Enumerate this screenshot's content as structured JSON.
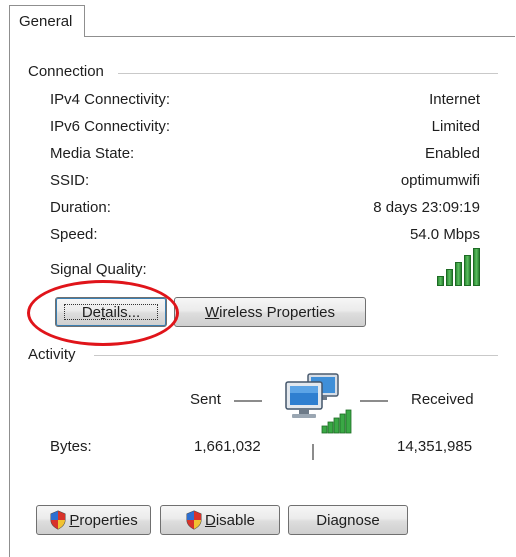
{
  "tabs": [
    {
      "label": "General"
    }
  ],
  "connection": {
    "title": "Connection",
    "rows": [
      {
        "label": "IPv4 Connectivity:",
        "value": "Internet"
      },
      {
        "label": "IPv6 Connectivity:",
        "value": "Limited"
      },
      {
        "label": "Media State:",
        "value": "Enabled"
      },
      {
        "label": "SSID:",
        "value": "optimumwifi"
      },
      {
        "label": "Duration:",
        "value": "8 days 23:09:19"
      },
      {
        "label": "Speed:",
        "value": "54.0 Mbps"
      }
    ],
    "signal_label": "Signal Quality:",
    "signal_bars_filled": 5,
    "signal_bars_total": 5,
    "details_button": {
      "prefix": "De",
      "underlined": "t",
      "suffix": "ails..."
    },
    "wireless_button": {
      "underlined": "W",
      "suffix": "ireless Properties"
    }
  },
  "activity": {
    "title": "Activity",
    "sent_label": "Sent",
    "received_label": "Received",
    "bytes_label": "Bytes:",
    "bytes_sent": "1,661,032",
    "bytes_received": "14,351,985"
  },
  "buttons": {
    "properties": {
      "underlined": "P",
      "suffix": "roperties"
    },
    "disable": {
      "underlined": "D",
      "suffix": "isable"
    },
    "diagnose": {
      "label": "Diagnose"
    }
  },
  "colors": {
    "highlight": "#e0141a",
    "signal_green": "#3aa845",
    "focus_blue": "#3c7fb1"
  },
  "icons": {
    "signal": "signal-strength-icon",
    "network": "network-computers-icon",
    "shield": "uac-shield-icon"
  }
}
